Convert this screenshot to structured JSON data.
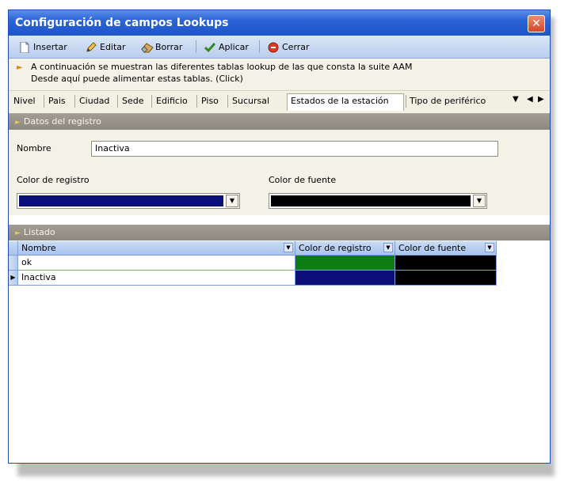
{
  "window": {
    "title": "Configuración de campos Lookups",
    "close_glyph": "✕"
  },
  "toolbar": {
    "insert_label": "Insertar",
    "edit_label": "Editar",
    "delete_label": "Borrar",
    "apply_label": "Aplicar",
    "close_label": "Cerrar"
  },
  "info": {
    "line1": "A continuación se muestran las diferentes tablas lookup de las que consta la suite AAM",
    "line2": "Desde aquí puede alimentar estas tablas. (Click)"
  },
  "tabs": {
    "items": [
      "Nivel",
      "Pais",
      "Ciudad",
      "Sede",
      "Edificio",
      "Piso",
      "Sucursal",
      "Estados de la estación",
      "Tipo de periférico"
    ],
    "active": "Estados de la estación"
  },
  "groups": {
    "record_header": "Datos del registro",
    "list_header": "Listado"
  },
  "form": {
    "name_label": "Nombre",
    "name_value": "Inactiva",
    "record_color_label": "Color de registro",
    "record_color": "#0a0f7a",
    "font_color_label": "Color de fuente",
    "font_color": "#000000"
  },
  "grid": {
    "columns": [
      "Nombre",
      "Color de registro",
      "Color de fuente"
    ],
    "rows": [
      {
        "name": "ok",
        "record_color": "#0b7d12",
        "font_color": "#000000",
        "current": false
      },
      {
        "name": "Inactiva",
        "record_color": "#0a0f7a",
        "font_color": "#000000",
        "current": true
      }
    ],
    "current_row_glyph": "▶"
  },
  "icons": {
    "insert": "document-icon",
    "edit": "pencil-icon",
    "delete": "eraser-icon",
    "apply": "checkmark-icon",
    "close": "stop-icon",
    "info": "arrow-right-icon",
    "dropdown": "chevron-down-icon"
  }
}
